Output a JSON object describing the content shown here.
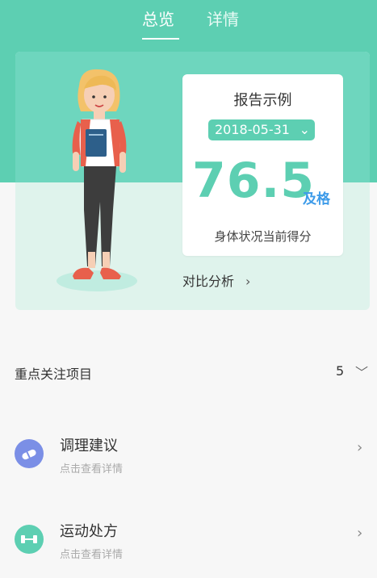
{
  "tabs": {
    "overview": "总览",
    "detail": "详情"
  },
  "report": {
    "title": "报告示例",
    "date": "2018-05-31",
    "score": "76.5",
    "grade": "及格",
    "caption": "身体状况当前得分"
  },
  "compare": {
    "label": "对比分析",
    "chev": "›"
  },
  "focus": {
    "title": "重点关注项目",
    "count": "5",
    "chev": "﹀"
  },
  "items": [
    {
      "title": "调理建议",
      "subtitle": "点击查看详情",
      "icon": "pill-icon",
      "color": "#7b8fe6"
    },
    {
      "title": "运动处方",
      "subtitle": "点击查看详情",
      "icon": "dumbbell-icon",
      "color": "#5dcfb2"
    }
  ],
  "colors": {
    "accent": "#5dcfb2",
    "grade": "#3d9be9"
  }
}
